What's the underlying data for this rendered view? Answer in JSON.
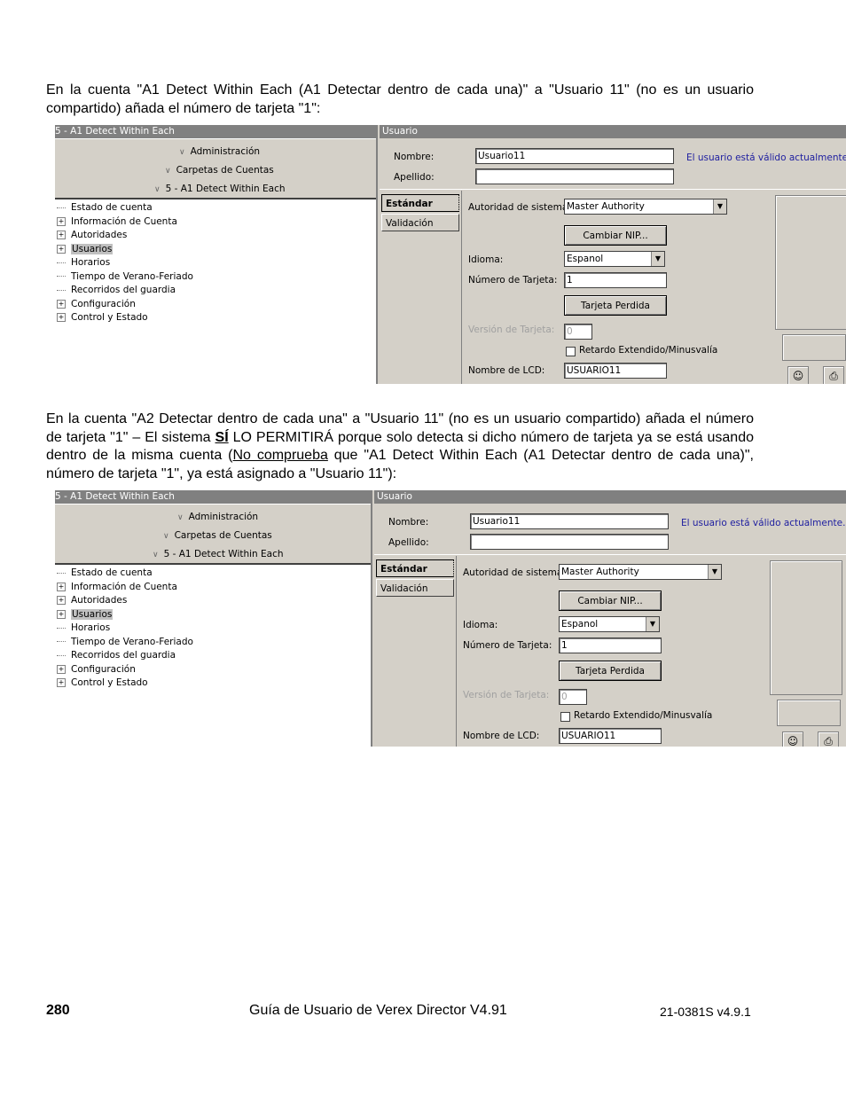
{
  "para1": "En la cuenta \"A1 Detect Within Each (A1 Detectar dentro de cada una)\" a \"Usuario 11\" (no es un usuario compartido) añada el número de tarjeta \"1\":",
  "para2": {
    "a": "En la cuenta \"A2 Detectar dentro de cada una\" a \"Usuario 11\" (no es un usuario compartido) añada el número de tarjeta \"1\" – El sistema ",
    "si": "SÍ",
    "b": " LO PERMITIRÁ porque solo detecta si dicho número de tarjeta ya se está usando dentro de la misma cuenta (",
    "nc": "No comprueba",
    "c": " que \"A1 Detect Within Each (A1 Detectar dentro de cada una)\", número de tarjeta \"1\", ya está asignado a \"Usuario 11\"):"
  },
  "shot": {
    "left_title": "5 - A1 Detect Within Each",
    "nav": [
      "Administración",
      "Carpetas de Cuentas",
      "5 - A1 Detect Within Each"
    ],
    "tree": [
      {
        "label": "Estado de cuenta",
        "expand": false
      },
      {
        "label": "Información de Cuenta",
        "expand": true
      },
      {
        "label": "Autoridades",
        "expand": true
      },
      {
        "label": "Usuarios",
        "expand": true
      },
      {
        "label": "Horarios",
        "expand": false
      },
      {
        "label": "Tiempo de Verano-Feriado",
        "expand": false
      },
      {
        "label": "Recorridos del guardia",
        "expand": false
      },
      {
        "label": "Configuración",
        "expand": true
      },
      {
        "label": "Control y Estado",
        "expand": true
      }
    ],
    "right_title": "Usuario",
    "nombre_label": "Nombre:",
    "nombre_value": "Usuario11",
    "apellido_label": "Apellido:",
    "valid_msg": "El usuario está válido actualmente.",
    "tab_standard": "Estándar",
    "tab_validation": "Validación",
    "authority_label": "Autoridad de sistema:",
    "authority_value": "Master Authority",
    "btn_pin": "Cambiar NIP...",
    "language_label": "Idioma:",
    "language_value": "Espanol",
    "card_label": "Número de Tarjeta:",
    "card_value": "1",
    "btn_lost": "Tarjeta Perdida",
    "card_version_label": "Versión de Tarjeta:",
    "card_version_value": "0",
    "extended_label": "Retardo Extendido/Minusvalía",
    "lcd_label": "Nombre de LCD:",
    "lcd_value": "USUARIO11"
  },
  "footer": {
    "page": "280",
    "title": "Guía de Usuario de Verex Director V4.91",
    "code": "21-0381S v4.9.1"
  }
}
